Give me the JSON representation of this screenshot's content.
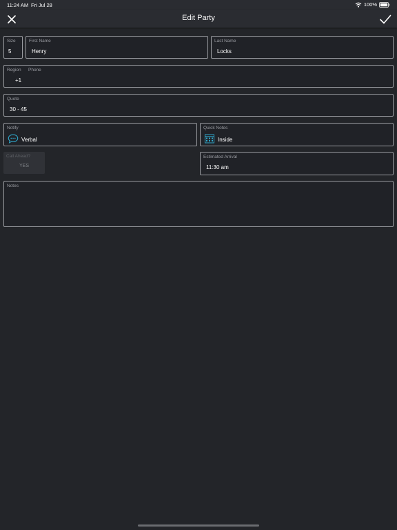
{
  "status_bar": {
    "time": "11:24 AM",
    "date": "Fri Jul 28",
    "battery": "100%"
  },
  "nav": {
    "title": "Edit Party",
    "close_icon": "close-icon",
    "done_icon": "checkmark-icon"
  },
  "form": {
    "size": {
      "label": "Size",
      "value": "5"
    },
    "first_name": {
      "label": "First Name",
      "value": "Henry"
    },
    "last_name": {
      "label": "Last Name",
      "value": "Locks"
    },
    "region": {
      "label": "Region",
      "value": "+1"
    },
    "phone": {
      "label": "Phone",
      "value": ""
    },
    "quote": {
      "label": "Quote",
      "value": "30 - 45"
    },
    "notify": {
      "label": "Notify",
      "value": "Verbal",
      "icon": "speech-bubble-icon"
    },
    "quick_notes": {
      "label": "Quick Notes",
      "value": "Inside",
      "icon": "building-icon"
    },
    "call_ahead": {
      "label": "Call Ahead?",
      "value": "YES"
    },
    "estimated_arrival": {
      "label": "Estimated Arrival",
      "value": "11:30 am"
    },
    "notes": {
      "label": "Notes",
      "value": ""
    }
  },
  "colors": {
    "background": "#232529",
    "accent": "#2fa6c9",
    "border": "#9a9ca1"
  }
}
